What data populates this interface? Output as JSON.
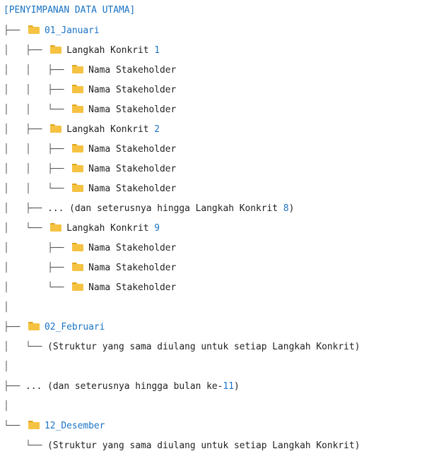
{
  "tree": {
    "root": "[PENYIMPANAN DATA UTAMA]",
    "jan": "01_Januari",
    "step_label": "Langkah Konkrit",
    "step1": "1",
    "step2": "2",
    "step9": "9",
    "stakeholder": "Nama Stakeholder",
    "cont_steps_pre": "... (dan seterusnya hingga Langkah Konkrit ",
    "cont_steps_num": "8",
    "cont_steps_post": ")",
    "feb": "02_Februari",
    "repeat_note": "(Struktur yang sama diulang untuk setiap Langkah Konkrit)",
    "cont_months_pre": "... (dan seterusnya hingga bulan ke-",
    "cont_months_num": "11",
    "cont_months_post": ")",
    "dec": "12_Desember"
  },
  "colors": {
    "link": "#1a73c4",
    "folder": "#f5c242",
    "text": "#1f1f1f"
  },
  "icons": {
    "folder": "folder-icon"
  }
}
